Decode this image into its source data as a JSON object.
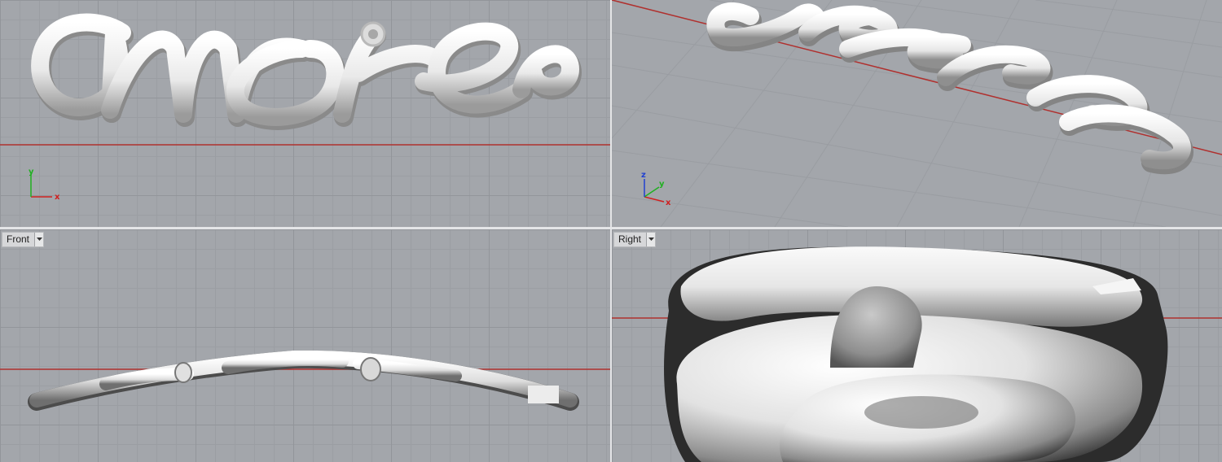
{
  "viewports": {
    "top": {
      "label": "",
      "axes": {
        "x": "x",
        "y": "y"
      }
    },
    "perspective": {
      "label": "",
      "axes": {
        "x": "x",
        "y": "y",
        "z": "z"
      }
    },
    "front": {
      "label": "Front"
    },
    "right": {
      "label": "Right"
    }
  },
  "model": {
    "text": "amore"
  },
  "colors": {
    "viewport_bg": "#a3a6ab",
    "grid_major": "#92959a",
    "grid_minor": "#9b9ea3",
    "x_axis_line": "#b0302e",
    "axis_x": "#d02020",
    "axis_y": "#20b020",
    "axis_z": "#2040d0",
    "model_fill": "#e8e8e8",
    "splitter": "#e4e5e7"
  },
  "icons": {
    "viewport_dropdown": "triangle-down-icon",
    "gumball": "axis-gizmo-icon"
  }
}
